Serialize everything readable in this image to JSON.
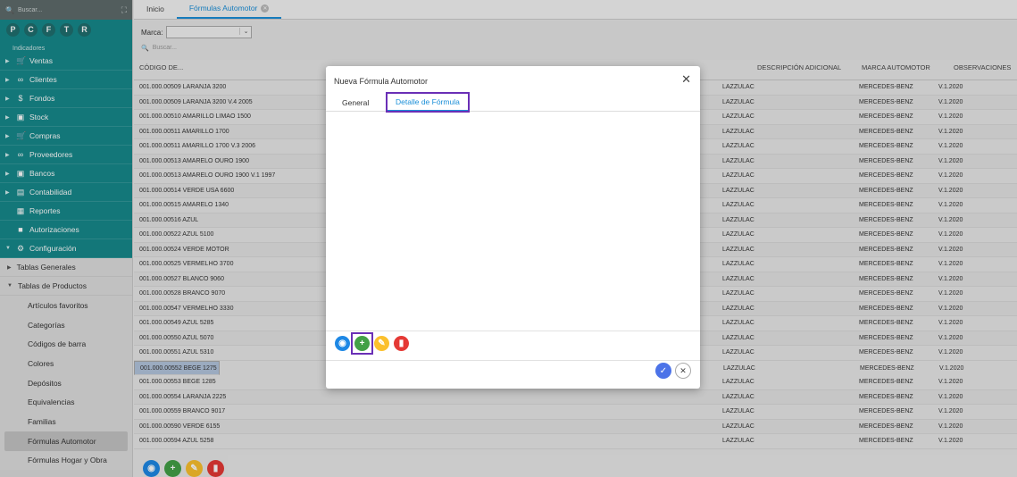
{
  "sidebar": {
    "search_placeholder": "Buscar...",
    "expand_icon": "⛶",
    "shortcuts": [
      "P",
      "C",
      "F",
      "T",
      "R"
    ],
    "partial_item": "Indicadores",
    "items": [
      {
        "label": "Ventas",
        "icon": "cart-icon"
      },
      {
        "label": "Clientes",
        "icon": "users-icon"
      },
      {
        "label": "Fondos",
        "icon": "dollar-icon"
      },
      {
        "label": "Stock",
        "icon": "box-icon"
      },
      {
        "label": "Compras",
        "icon": "cart-icon"
      },
      {
        "label": "Proveedores",
        "icon": "users-icon"
      },
      {
        "label": "Bancos",
        "icon": "bank-icon"
      },
      {
        "label": "Contabilidad",
        "icon": "book-icon"
      },
      {
        "label": "Reportes",
        "icon": "report-icon"
      },
      {
        "label": "Autorizaciones",
        "icon": "lock-icon"
      },
      {
        "label": "Configuración",
        "icon": "gear-icon"
      }
    ],
    "config_subs": [
      "Tablas Generales",
      "Tablas de Productos"
    ],
    "leaves": [
      "Artículos favoritos",
      "Categorías",
      "Códigos de barra",
      "Colores",
      "Depósitos",
      "Equivalencias",
      "Familias",
      "Fórmulas Automotor",
      "Fórmulas Hogar y Obra"
    ]
  },
  "tabs": {
    "home": "Inicio",
    "active": "Fórmulas Automotor"
  },
  "filters": {
    "marca_label": "Marca:",
    "search_placeholder": "Buscar..."
  },
  "table": {
    "headers": [
      "CÓDIGO DE...",
      "DESCRIPCIÓN ADICIONAL",
      "MARCA AUTOMOTOR",
      "OBSERVACIONES"
    ],
    "rows": [
      [
        "001.000.00509 LARANJA 3200",
        "LAZZULAC",
        "MERCEDES-BENZ",
        "V.1.2020"
      ],
      [
        "001.000.00509 LARANJA 3200 V.4 2005",
        "LAZZULAC",
        "MERCEDES-BENZ",
        "V.1.2020"
      ],
      [
        "001.000.00510 AMARILLO LIMAO 1500",
        "LAZZULAC",
        "MERCEDES-BENZ",
        "V.1.2020"
      ],
      [
        "001.000.00511 AMARILLO 1700",
        "LAZZULAC",
        "MERCEDES-BENZ",
        "V.1.2020"
      ],
      [
        "001.000.00511 AMARILLO 1700 V.3 2006",
        "LAZZULAC",
        "MERCEDES-BENZ",
        "V.1.2020"
      ],
      [
        "001.000.00513 AMARELO OURO 1900",
        "LAZZULAC",
        "MERCEDES-BENZ",
        "V.1.2020"
      ],
      [
        "001.000.00513 AMARELO OURO 1900 V.1 1997",
        "LAZZULAC",
        "MERCEDES-BENZ",
        "V.1.2020"
      ],
      [
        "001.000.00514 VERDE USA 6600",
        "LAZZULAC",
        "MERCEDES-BENZ",
        "V.1.2020"
      ],
      [
        "001.000.00515 AMARELO 1340",
        "LAZZULAC",
        "MERCEDES-BENZ",
        "V.1.2020"
      ],
      [
        "001.000.00516 AZUL",
        "LAZZULAC",
        "MERCEDES-BENZ",
        "V.1.2020"
      ],
      [
        "001.000.00522 AZUL 5100",
        "LAZZULAC",
        "MERCEDES-BENZ",
        "V.1.2020"
      ],
      [
        "001.000.00524 VERDE MOTOR",
        "LAZZULAC",
        "MERCEDES-BENZ",
        "V.1.2020"
      ],
      [
        "001.000.00525 VERMELHO 3700",
        "LAZZULAC",
        "MERCEDES-BENZ",
        "V.1.2020"
      ],
      [
        "001.000.00527 BLANCO 9060",
        "LAZZULAC",
        "MERCEDES-BENZ",
        "V.1.2020"
      ],
      [
        "001.000.00528 BRANCO 9070",
        "LAZZULAC",
        "MERCEDES-BENZ",
        "V.1.2020"
      ],
      [
        "001.000.00547 VERMELHO 3330",
        "LAZZULAC",
        "MERCEDES-BENZ",
        "V.1.2020"
      ],
      [
        "001.000.00549 AZUL 5285",
        "LAZZULAC",
        "MERCEDES-BENZ",
        "V.1.2020"
      ],
      [
        "001.000.00550 AZUL 5070",
        "LAZZULAC",
        "MERCEDES-BENZ",
        "V.1.2020"
      ],
      [
        "001.000.00551 AZUL 5310",
        "LAZZULAC",
        "MERCEDES-BENZ",
        "V.1.2020"
      ],
      [
        "001.000.00552 BEGE 1275",
        "LAZZULAC",
        "MERCEDES-BENZ",
        "V.1.2020"
      ],
      [
        "001.000.00553 BEGE 1285",
        "LAZZULAC",
        "MERCEDES-BENZ",
        "V.1.2020"
      ],
      [
        "001.000.00554 LARANJA 2225",
        "LAZZULAC",
        "MERCEDES-BENZ",
        "V.1.2020"
      ],
      [
        "001.000.00559 BRANCO 9017",
        "LAZZULAC",
        "MERCEDES-BENZ",
        "V.1.2020"
      ],
      [
        "001.000.00590 VERDE 6155",
        "LAZZULAC",
        "MERCEDES-BENZ",
        "V.1.2020"
      ],
      [
        "001.000.00594 AZUL 5258",
        "LAZZULAC",
        "MERCEDES-BENZ",
        "V.1.2020"
      ]
    ],
    "selected_row": 19
  },
  "modal": {
    "title": "Nueva Fórmula Automotor",
    "close": "✕",
    "tabs": [
      "General",
      "Detalle de Fórmula"
    ],
    "active_tab": "Detalle de Fórmula"
  },
  "colors": {
    "teal": "#16898b",
    "accent": "#1b8fd8",
    "highlight": "#6a2fb6"
  }
}
